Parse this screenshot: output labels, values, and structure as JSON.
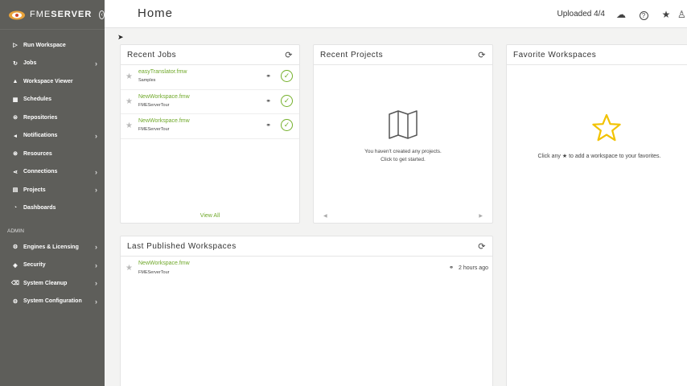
{
  "brand": {
    "name_light": "FME",
    "name_bold": "SERVER"
  },
  "sidebar": {
    "items": [
      {
        "label": "Run Workspace",
        "icon": "▷",
        "chevron": false
      },
      {
        "label": "Jobs",
        "icon": "↻",
        "chevron": true
      },
      {
        "label": "Workspace Viewer",
        "icon": "▲",
        "chevron": false
      },
      {
        "label": "Schedules",
        "icon": "▦",
        "chevron": false
      },
      {
        "label": "Repositories",
        "icon": "⊜",
        "chevron": false
      },
      {
        "label": "Notifications",
        "icon": "◂",
        "chevron": true
      },
      {
        "label": "Resources",
        "icon": "⊛",
        "chevron": false
      },
      {
        "label": "Connections",
        "icon": "⋖",
        "chevron": true
      },
      {
        "label": "Projects",
        "icon": "▤",
        "chevron": true
      },
      {
        "label": "Dashboards",
        "icon": "◔",
        "chevron": false
      }
    ],
    "admin_label": "ADMIN",
    "admin_items": [
      {
        "label": "Engines & Licensing",
        "icon": "⚙",
        "chevron": true
      },
      {
        "label": "Security",
        "icon": "◈",
        "chevron": true
      },
      {
        "label": "System Cleanup",
        "icon": "⌫",
        "chevron": true
      },
      {
        "label": "System Configuration",
        "icon": "⚙",
        "chevron": true
      }
    ]
  },
  "header": {
    "title": "Home",
    "uploaded": "Uploaded 4/4",
    "upload_icon": "☁",
    "help_icon": "?",
    "favorites_icon": "★",
    "user_icon": "♙"
  },
  "recent_jobs": {
    "title": "Recent Jobs",
    "jobs": [
      {
        "name": "easyTranslator.fmw",
        "repo": "Samples"
      },
      {
        "name": "NewWorkspace.fmw",
        "repo": "FMEServerTour"
      },
      {
        "name": "NewWorkspace.fmw",
        "repo": "FMEServerTour"
      }
    ],
    "view_all": "View All"
  },
  "recent_projects": {
    "title": "Recent Projects",
    "empty_line1": "You haven't created any projects.",
    "empty_line2": "Click to get started."
  },
  "favorite_workspaces": {
    "title": "Favorite Workspaces",
    "msg_before": "Click any",
    "msg_after": "to add a workspace to your favorites."
  },
  "last_published": {
    "title": "Last Published Workspaces",
    "items": [
      {
        "name": "NewWorkspace.fmw",
        "repo": "FMEServerTour",
        "time": "2 hours ago"
      }
    ]
  },
  "colors": {
    "sidebar": "#5e5e5a",
    "accent_green": "#6fa829",
    "star_yellow": "#f2c200"
  }
}
